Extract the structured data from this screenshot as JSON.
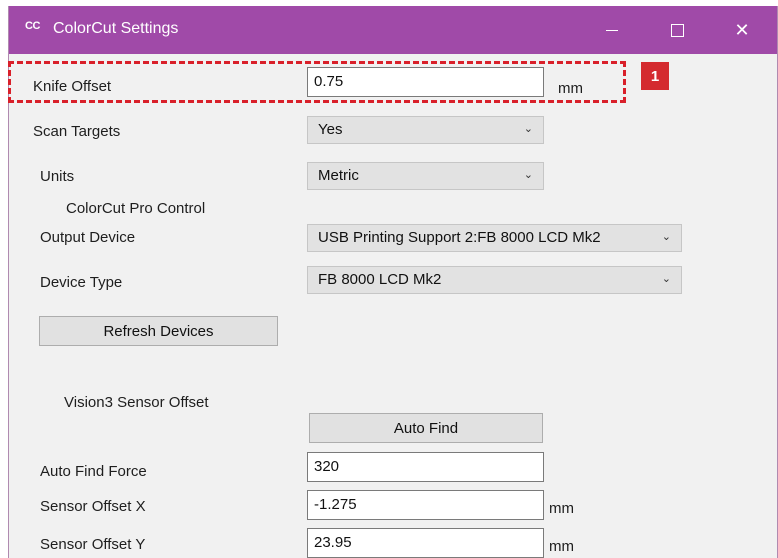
{
  "window": {
    "logo": "CC",
    "title": "ColorCut Settings",
    "accent_color": "#a04aa8"
  },
  "knife_offset": {
    "label": "Knife Offset",
    "value": "0.75",
    "unit": "mm"
  },
  "scan_targets": {
    "label": "Scan Targets",
    "value": "Yes"
  },
  "units": {
    "label": "Units",
    "value": "Metric"
  },
  "pro_control": {
    "heading": "ColorCut Pro Control"
  },
  "output_device": {
    "label": "Output Device",
    "value": "USB Printing Support 2:FB 8000 LCD Mk2"
  },
  "device_type": {
    "label": "Device Type",
    "value": "FB 8000 LCD Mk2"
  },
  "refresh_button": "Refresh Devices",
  "vision3": {
    "heading": "Vision3 Sensor Offset",
    "auto_find_button": "Auto Find"
  },
  "auto_find_force": {
    "label": "Auto Find Force",
    "value": "320"
  },
  "sensor_offset_x": {
    "label": "Sensor Offset X",
    "value": "-1.275",
    "unit": "mm"
  },
  "sensor_offset_y": {
    "label": "Sensor Offset Y",
    "value": "23.95",
    "unit": "mm"
  },
  "callout": {
    "number": "1",
    "color": "#d42a2f"
  }
}
